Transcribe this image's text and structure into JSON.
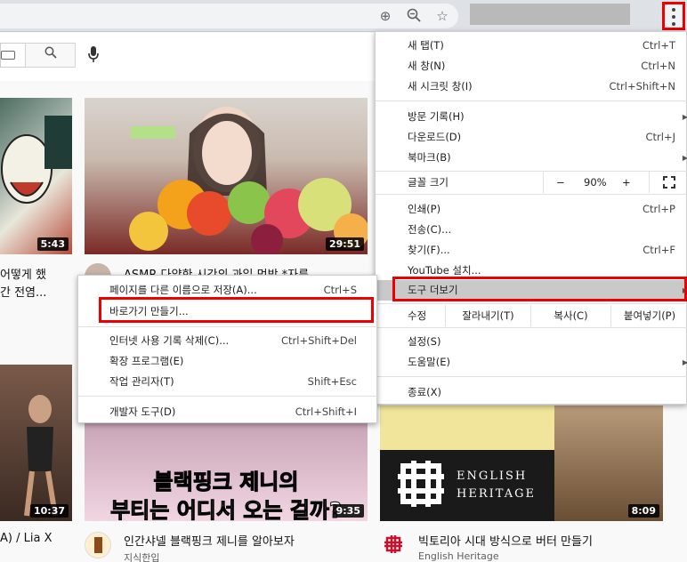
{
  "main_menu": {
    "items": [
      {
        "label": "새 탭(T)",
        "shortcut": "Ctrl+T"
      },
      {
        "label": "새 창(N)",
        "shortcut": "Ctrl+N"
      },
      {
        "label": "새 시크릿 창(I)",
        "shortcut": "Ctrl+Shift+N"
      },
      {
        "label": "방문 기록(H)",
        "shortcut": ""
      },
      {
        "label": "다운로드(D)",
        "shortcut": "Ctrl+J"
      },
      {
        "label": "북마크(B)",
        "shortcut": ""
      },
      {
        "label": "인쇄(P)",
        "shortcut": "Ctrl+P"
      },
      {
        "label": "전송(C)...",
        "shortcut": ""
      },
      {
        "label": "찾기(F)...",
        "shortcut": "Ctrl+F"
      },
      {
        "label": "YouTube 설치...",
        "shortcut": ""
      },
      {
        "label": "도구 더보기",
        "shortcut": ""
      },
      {
        "label": "설정(S)",
        "shortcut": ""
      },
      {
        "label": "도움말(E)",
        "shortcut": ""
      },
      {
        "label": "종료(X)",
        "shortcut": ""
      }
    ],
    "zoom": {
      "label": "글꼴 크기",
      "minus": "−",
      "value": "90%",
      "plus": "+"
    },
    "edit": {
      "label": "수정",
      "cut": "잘라내기(T)",
      "copy": "복사(C)",
      "paste": "붙여넣기(P)"
    }
  },
  "sub_menu": {
    "items": [
      {
        "label": "페이지를 다른 이름으로 저장(A)...",
        "shortcut": "Ctrl+S"
      },
      {
        "label": "바로가기 만들기...",
        "shortcut": ""
      },
      {
        "label": "인터넷 사용 기록 삭제(C)...",
        "shortcut": "Ctrl+Shift+Del"
      },
      {
        "label": "확장 프로그램(E)",
        "shortcut": ""
      },
      {
        "label": "작업 관리자(T)",
        "shortcut": "Shift+Esc"
      },
      {
        "label": "개발자 도구(D)",
        "shortcut": "Ctrl+Shift+I"
      }
    ]
  },
  "videos": [
    {
      "duration": "5:43",
      "title_l1": "어떻게 했",
      "title_l2": "간 전염..."
    },
    {
      "duration": "29:51",
      "title": "ASMR 다양한 시간의 과일 먹방 *자른"
    },
    {
      "duration": "10:37",
      "title": "A) / Lia X"
    },
    {
      "duration": "9:35",
      "title": "인간샤넬 블랙핑크 제니를 알아보자",
      "channel": "지식한입",
      "overlay_l1": "블랙핑크 제니의",
      "overlay_l2": "부티는 어디서 오는 걸까?"
    },
    {
      "duration": "8:09",
      "title": "빅토리아 시대 방식으로 버터 만들기",
      "channel": "English Heritage",
      "overlay_l1": "ENGLISH",
      "overlay_l2": "HERITAGE"
    }
  ]
}
